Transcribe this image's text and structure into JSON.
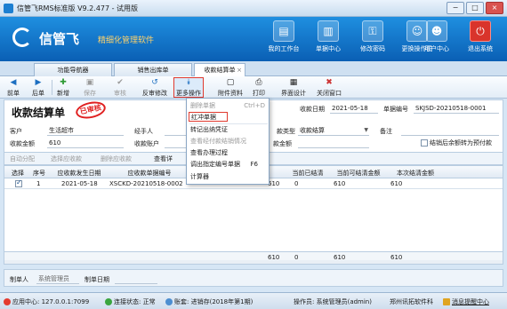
{
  "window": {
    "title": "信管飞RMS标准版 V9.2.477 - 试用版",
    "min": "−",
    "max": "□",
    "close": "×"
  },
  "banner": {
    "brand": "信管飞",
    "slogan": "精细化管理软件",
    "items": [
      {
        "label": "我的工作台",
        "icon": "desk-icon",
        "glyph": "▤"
      },
      {
        "label": "单据中心",
        "icon": "docs-icon",
        "glyph": "▥"
      },
      {
        "label": "修改密码",
        "icon": "key-icon",
        "glyph": "⚿"
      },
      {
        "label": "更换操作员",
        "icon": "user-switch-icon",
        "glyph": "☺"
      },
      {
        "label": "用户中心",
        "icon": "user-icon",
        "glyph": "☻"
      },
      {
        "label": "退出系统",
        "icon": "power-icon",
        "glyph": "⏻"
      }
    ]
  },
  "tabs": [
    {
      "label": "功能导航器"
    },
    {
      "label": "销售出库单"
    },
    {
      "label": "收款结算单",
      "close": "×"
    }
  ],
  "toolbar": {
    "prev": "前单",
    "next": "后单",
    "new": "新增",
    "save": "保存",
    "audit": "审核",
    "unaudit": "反审修改",
    "more": "更多操作",
    "attachment": "附件资料",
    "print": "打印",
    "design": "界面设计",
    "close": "关闭窗口"
  },
  "form": {
    "title": "收款结算单",
    "stamp": "已审核",
    "date_label": "收款日期",
    "date_value": "2021-05-18",
    "doc_no_label": "单据编号",
    "doc_no_value": "SKJSD-20210518-0001",
    "customer_label": "客户",
    "customer_value": "生活超市",
    "handler_label": "经手人",
    "type_label": "款类型",
    "type_value": "收款结算",
    "remark_label": "备注",
    "total_label": "收款金额",
    "total_value": "610",
    "account_label": "收款账户",
    "discount_label": "款金额",
    "auto_advance_label": "结销后余额转为预付款"
  },
  "subtoolbar": {
    "auto_alloc": "自动分配",
    "select_doc": "选择应收款",
    "delete_doc": "删除应收款",
    "view": "查看详"
  },
  "grid": {
    "headers": [
      "选择",
      "序号",
      "应收款发生日期",
      "应收款单据编号",
      "",
      "当前已结清",
      "当前可结清金额",
      "本次结清金额"
    ],
    "rows": [
      {
        "selected": true,
        "index": "1",
        "date": "2021-05-18",
        "doc_no": "XSCKD-20210518-0002",
        "amount": "610",
        "cleared": "0",
        "clearable": "610",
        "this_time": "610"
      }
    ],
    "sum": {
      "amount": "610",
      "cleared": "0",
      "clearable": "610",
      "this_time": "610"
    }
  },
  "footer": {
    "maker_label": "制单人",
    "maker_value": "系统管理员",
    "make_date_label": "制单日期"
  },
  "statusbar": {
    "server": "应用中心: 127.0.0.1:7099",
    "conn": "连接状态: 正常",
    "db": "账套: 进销存(2018年第1期)",
    "operator": "操作员: 系统管理员(admin)",
    "company": "郑州讯拓软件科",
    "msg": "消息提醒中心"
  },
  "menu": {
    "items": [
      {
        "label": "删除单据",
        "shortcut": "Ctrl+D",
        "disabled": true
      },
      {
        "label": "红冲单据",
        "highlight": true
      },
      {
        "label": "转记出纳凭证"
      },
      {
        "label": "查看经付款结销情况",
        "disabled": true
      },
      {
        "label": "查看办理过程"
      },
      {
        "label": "调出指定编号单据",
        "shortcut": "F6"
      },
      {
        "label": "计算器"
      }
    ]
  }
}
